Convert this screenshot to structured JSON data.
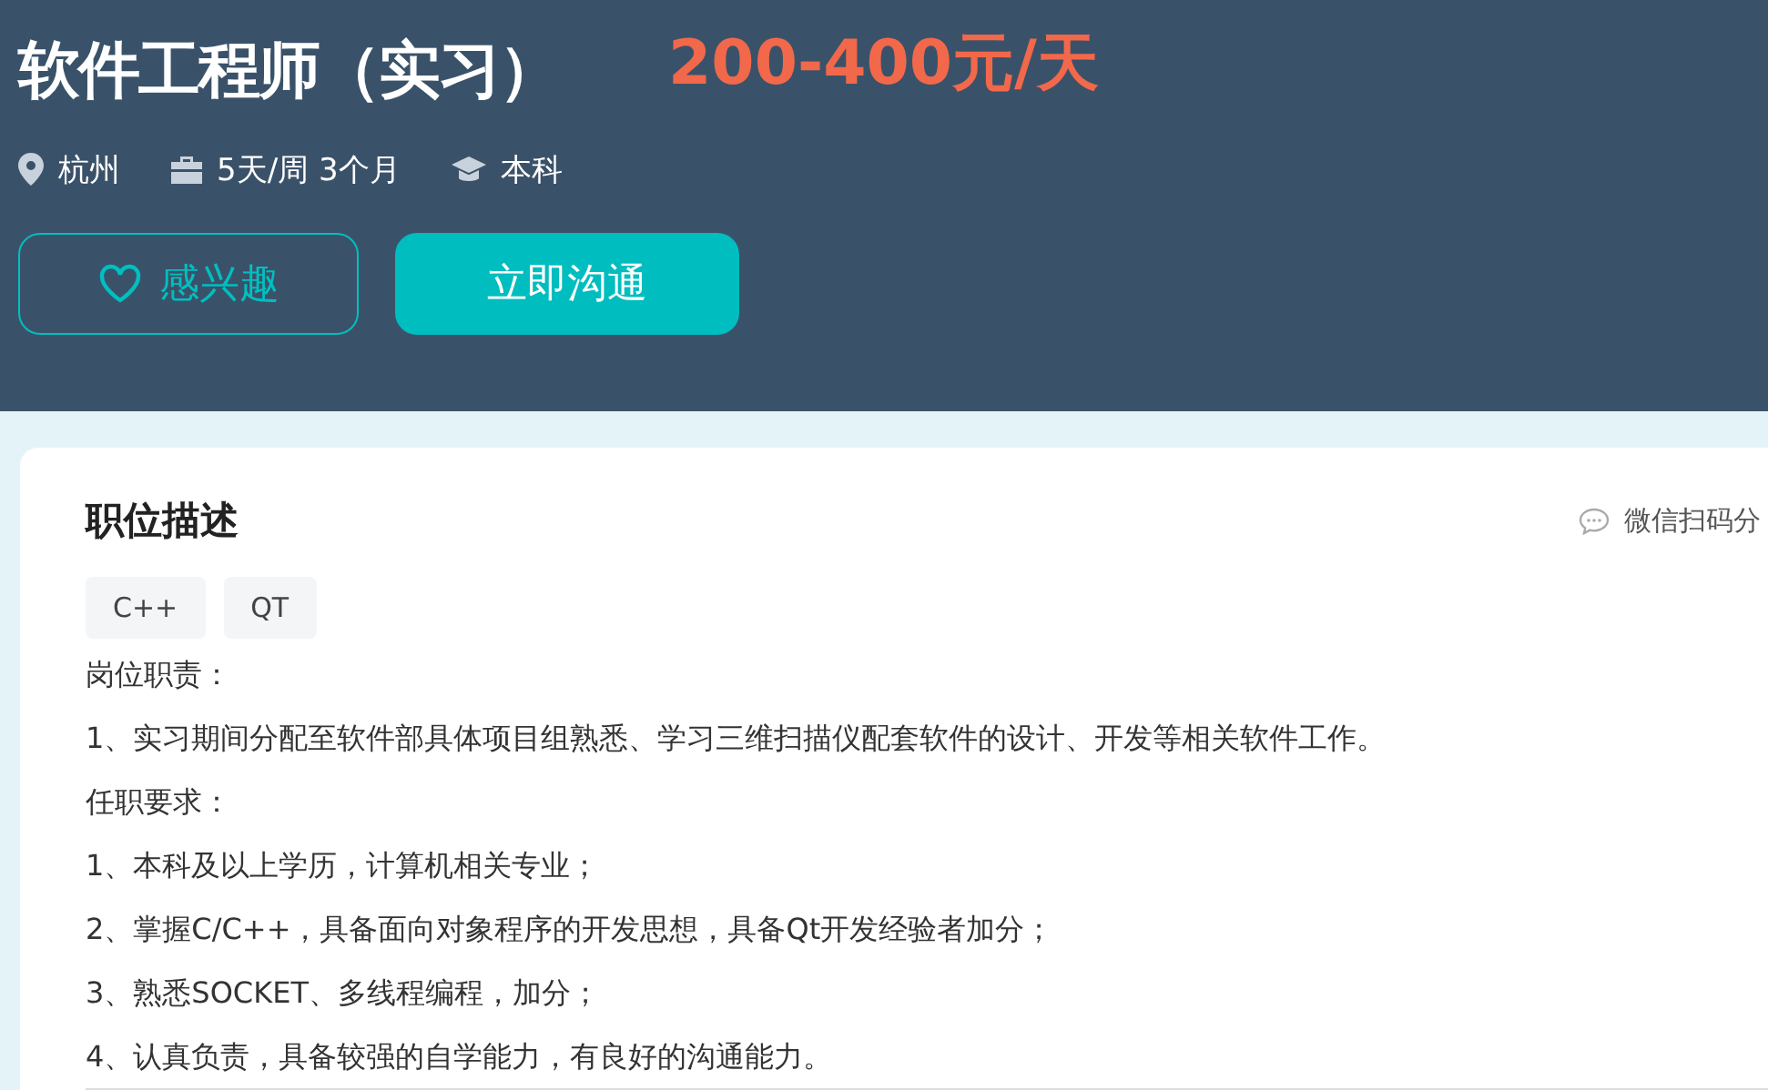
{
  "job": {
    "title": "软件工程师（实习）",
    "salary": "200-400元/天",
    "meta": [
      {
        "kind": "location",
        "text": "杭州"
      },
      {
        "kind": "schedule",
        "text": "5天/周 3个月"
      },
      {
        "kind": "degree",
        "text": "本科"
      }
    ],
    "buttons": [
      {
        "kind": "interest",
        "label": "感兴趣"
      },
      {
        "kind": "chat",
        "label": "立即沟通"
      }
    ]
  },
  "description": {
    "heading": "职位描述",
    "share": "微信扫码分",
    "tags": [
      "C++",
      "QT"
    ],
    "lines": [
      "岗位职责：",
      "1、实习期间分配至软件部具体项目组熟悉、学习三维扫描仪配套软件的设计、开发等相关软件工作。",
      "任职要求：",
      "1、本科及以上学历，计算机相关专业；",
      "2、掌握C/C++，具备面向对象程序的开发思想，具备Qt开发经验者加分；",
      "3、熟悉SOCKET、多线程编程，加分；",
      "4、认真负责，具备较强的自学能力，有良好的沟通能力。"
    ]
  }
}
